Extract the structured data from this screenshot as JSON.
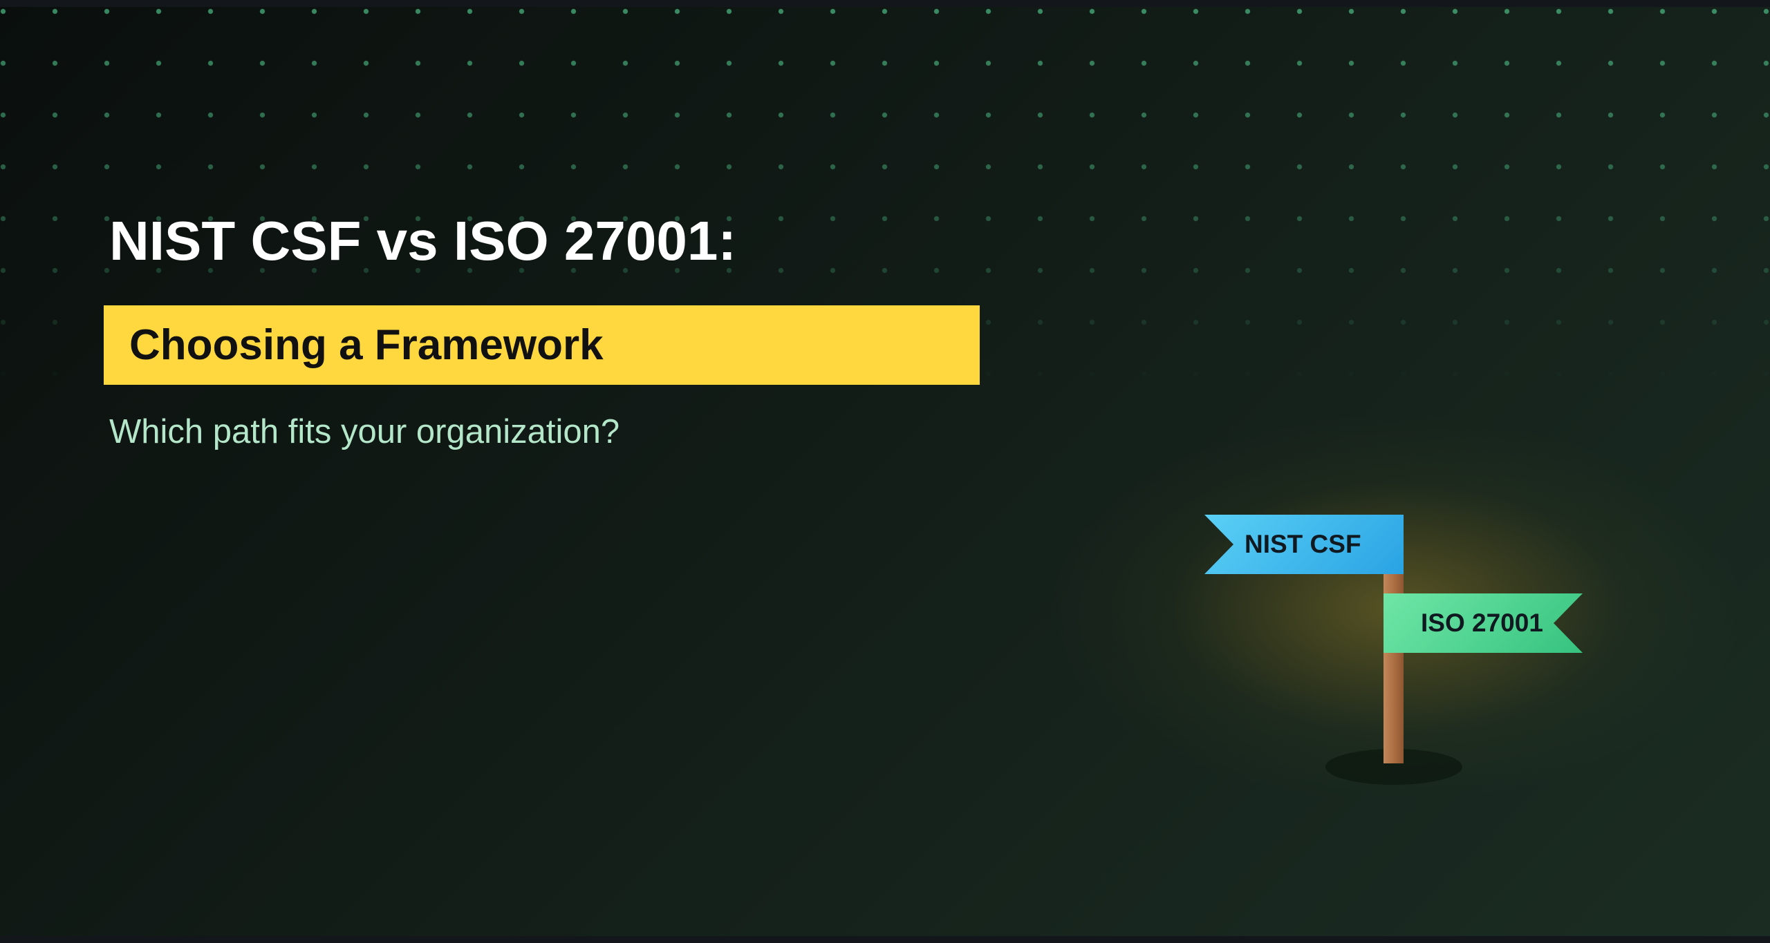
{
  "slide": {
    "headline": "NIST CSF vs ISO 27001:",
    "banner": "Choosing a Framework",
    "tagline": "Which path fits your organization?"
  },
  "signpost": {
    "sign_left": "NIST CSF",
    "sign_right": "ISO 27001"
  },
  "colors": {
    "background": "#111a15",
    "dots": "#4ab480",
    "banner": "#ffd83f",
    "tagline": "#b4e6c9",
    "sign_nist": "#2aa3e4",
    "sign_iso": "#36c37f",
    "pole": "#a86b3f"
  }
}
